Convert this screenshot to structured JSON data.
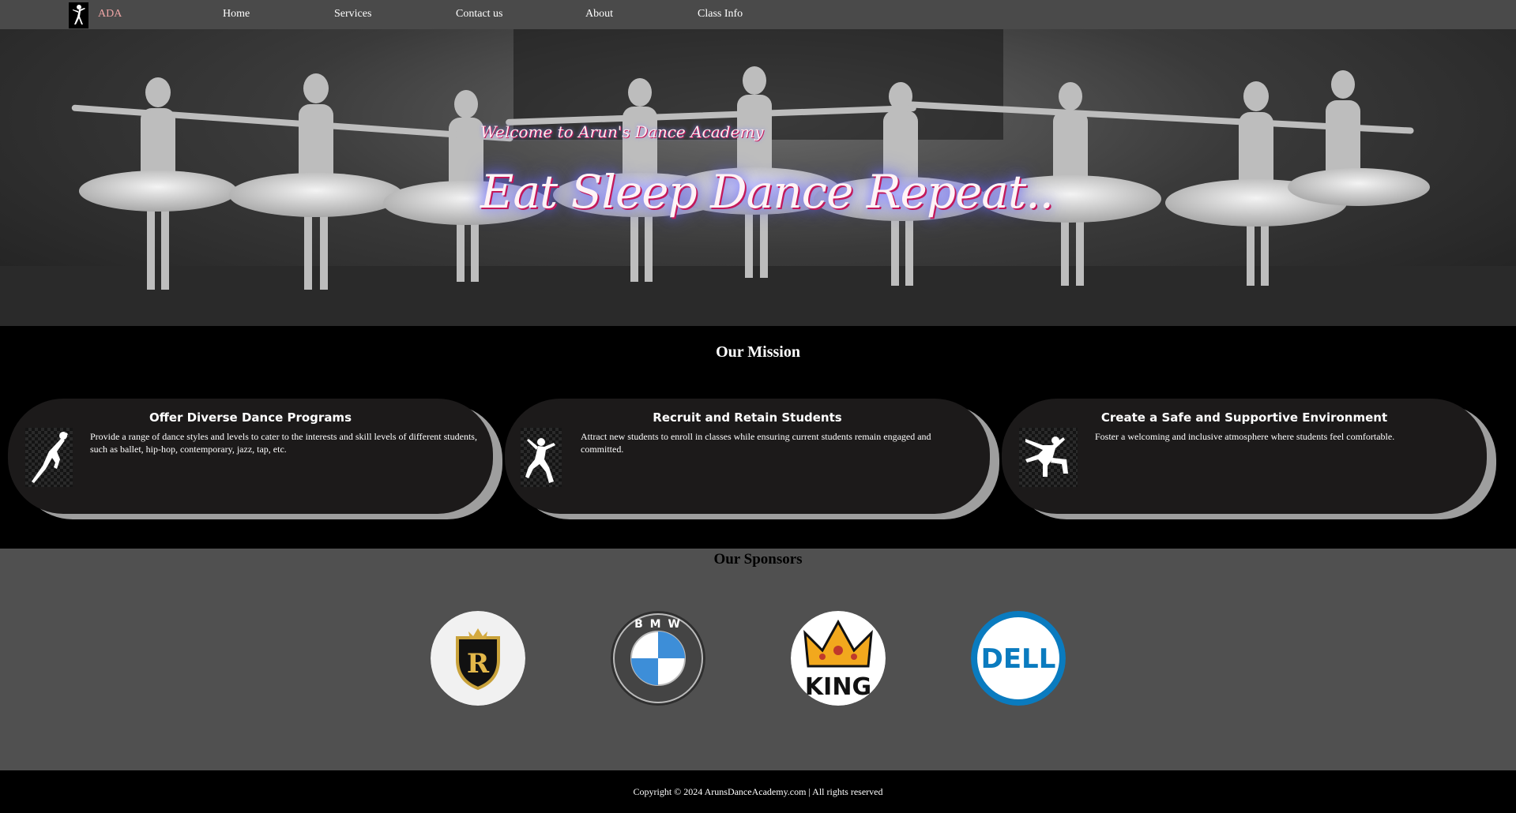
{
  "nav": {
    "brand": "ADA",
    "links": [
      "Home",
      "Services",
      "Contact us",
      "About",
      "Class Info"
    ]
  },
  "hero": {
    "subtitle": "Welcome to Arun's Dance Academy",
    "title": "Eat Sleep Dance Repeat.."
  },
  "mission": {
    "heading": "Our Mission",
    "cards": [
      {
        "title": "Offer Diverse Dance Programs",
        "text": "Provide a range of dance styles and levels to cater to the interests and skill levels of different students, such as ballet, hip-hop, contemporary, jazz, tap, etc.",
        "icon": "dancer-leap-icon"
      },
      {
        "title": "Recruit and Retain Students",
        "text": "Attract new students to enroll in classes while ensuring current students remain engaged and committed.",
        "icon": "dancer-jump-icon"
      },
      {
        "title": "Create a Safe and Supportive Environment",
        "text": "Foster a welcoming and inclusive atmosphere where students feel comfortable.",
        "icon": "breakdancer-icon"
      }
    ]
  },
  "sponsors": {
    "heading": "Our Sponsors",
    "logos": [
      {
        "name": "royal-crest-logo",
        "letter": "R"
      },
      {
        "name": "bmw-logo",
        "text": "B M W"
      },
      {
        "name": "king-logo",
        "text": "KING"
      },
      {
        "name": "dell-logo",
        "text": "DELL"
      }
    ]
  },
  "footer": {
    "copyright": "Copyright © 2024 ArunsDanceAcademy.com | All rights reserved"
  },
  "colors": {
    "navbar": "#4a4a4a",
    "brand": "#f0a6a6",
    "card": "#1c1a1a",
    "card_shadow": "#9e9e9e",
    "sponsors_bg": "#505050",
    "dell_blue": "#0a7bbf",
    "bmw_blue": "#3d8ed8"
  }
}
